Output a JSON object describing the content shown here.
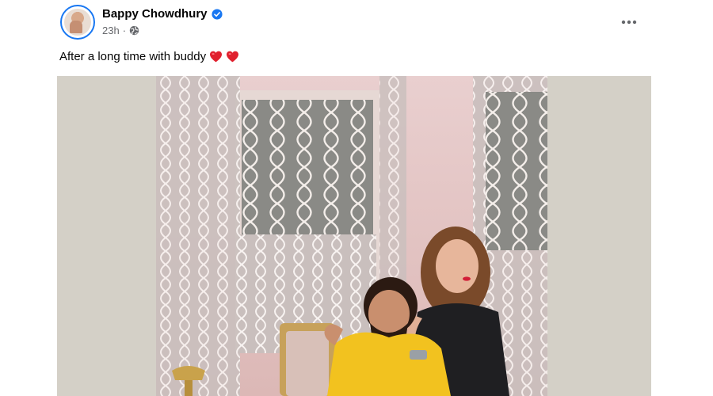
{
  "post": {
    "author": "Bappy Chowdhury",
    "verified": true,
    "time": "23h",
    "separator": "·",
    "privacy_icon": "globe-icon",
    "more_icon": "more-options-icon",
    "caption": "After a long time with buddy",
    "caption_emoji": [
      "heart-emoji",
      "heart-emoji"
    ]
  },
  "colors": {
    "verified_badge": "#1877f2",
    "meta_text": "#65676b",
    "photo_background": "#d4d0c7"
  }
}
